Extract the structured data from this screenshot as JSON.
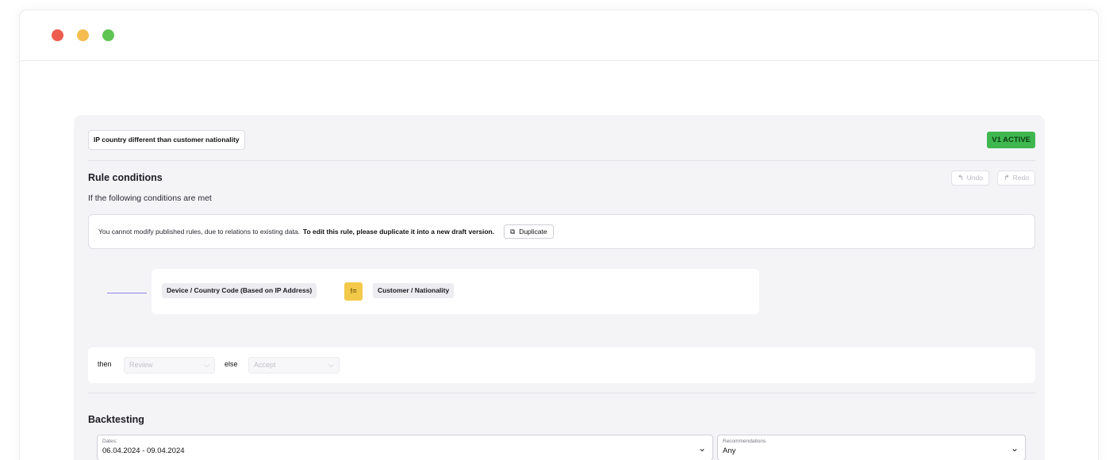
{
  "window": {
    "controls": [
      "close",
      "minimize",
      "maximize"
    ],
    "colors": {
      "close": "#ee5b4f",
      "minimize": "#f5bd4f",
      "maximize": "#5fc453"
    }
  },
  "rule": {
    "name": "IP country different than customer nationality",
    "version_badge": "V1 ACTIVE",
    "badge_color": "#3fb74f"
  },
  "conditions": {
    "title": "Rule conditions",
    "undo_label": "Undo",
    "redo_label": "Redo",
    "intro": "If the following conditions are met",
    "notice_text": "You cannot modify published rules, due to relations to existing data.",
    "notice_bold": "To edit this rule, please duplicate it into a new draft version.",
    "duplicate_label": "Duplicate",
    "left_operand": "Device / Country Code (Based on IP Address)",
    "operator": "!=",
    "right_operand": "Customer / Nationality"
  },
  "outcome": {
    "then_label": "then",
    "then_value": "Review",
    "else_label": "else",
    "else_value": "Accept"
  },
  "backtesting": {
    "title": "Backtesting",
    "dates_label": "Dates:",
    "dates_value": "06.04.2024 - 09.04.2024",
    "recommendations_label": "Recommendations",
    "recommendations_value": "Any"
  }
}
